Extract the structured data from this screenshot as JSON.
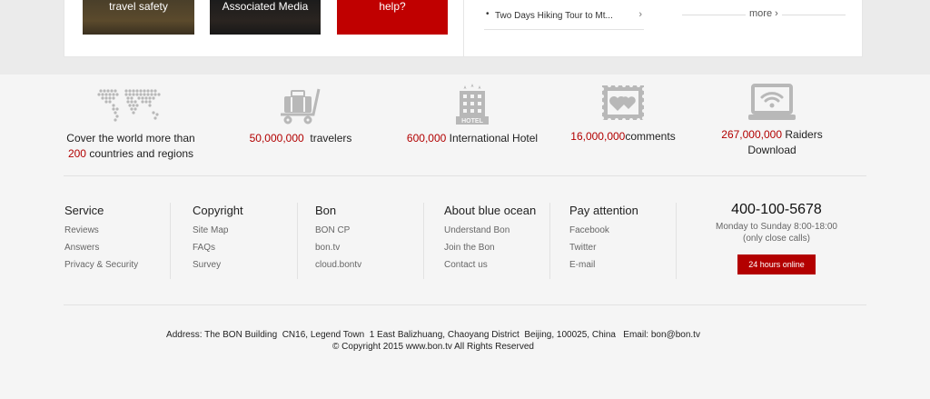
{
  "top": {
    "tiles": [
      "travel safety",
      "Associated Media",
      "help?"
    ],
    "news_item": "Two Days Hiking Tour to Mt...",
    "more_label": "more"
  },
  "stats": [
    {
      "icon": "world-map-icon",
      "red": "",
      "pre": "Cover the world more than",
      "red2": "200",
      "post": "countries and regions"
    },
    {
      "icon": "luggage-cart-icon",
      "red": "50,000,000",
      "pre": "",
      "red2": "",
      "post": "travelers"
    },
    {
      "icon": "hotel-icon",
      "red": "600,000",
      "pre": "",
      "red2": "",
      "post": "International Hotel"
    },
    {
      "icon": "stamp-hearts-icon",
      "red": "16,000,000",
      "pre": "",
      "red2": "",
      "post": "comments"
    },
    {
      "icon": "laptop-wifi-icon",
      "red": "267,000,000",
      "pre": "",
      "red2": "",
      "post": "Raiders Download"
    }
  ],
  "footer": {
    "columns": [
      {
        "title": "Service",
        "links": [
          "Reviews",
          "Answers",
          "Privacy & Security"
        ]
      },
      {
        "title": "Copyright",
        "links": [
          "Site Map",
          "FAQs",
          "Survey"
        ]
      },
      {
        "title": "Bon",
        "links": [
          "BON CP",
          "bon.tv",
          "cloud.bontv"
        ]
      },
      {
        "title": "About blue ocean",
        "links": [
          "Understand Bon",
          "Join the Bon",
          "Contact us"
        ]
      },
      {
        "title": "Pay attention",
        "links": [
          "Facebook",
          "Twitter",
          "E-mail"
        ]
      }
    ],
    "phone": "400-100-5678",
    "hours_line1": "Monday to Sunday 8:00-18:00",
    "hours_line2": "(only close calls)",
    "online_button": "24 hours online",
    "address": "Address: The BON Building  CN16, Legend Town  1 East Balizhuang, Chaoyang District  Beijing, 100025, China   Email: bon@bon.tv",
    "copyright": "© Copyright 2015 www.bon.tv All Rights Reserved"
  },
  "colors": {
    "accent_red": "#b20000",
    "button_red": "#b30000"
  }
}
